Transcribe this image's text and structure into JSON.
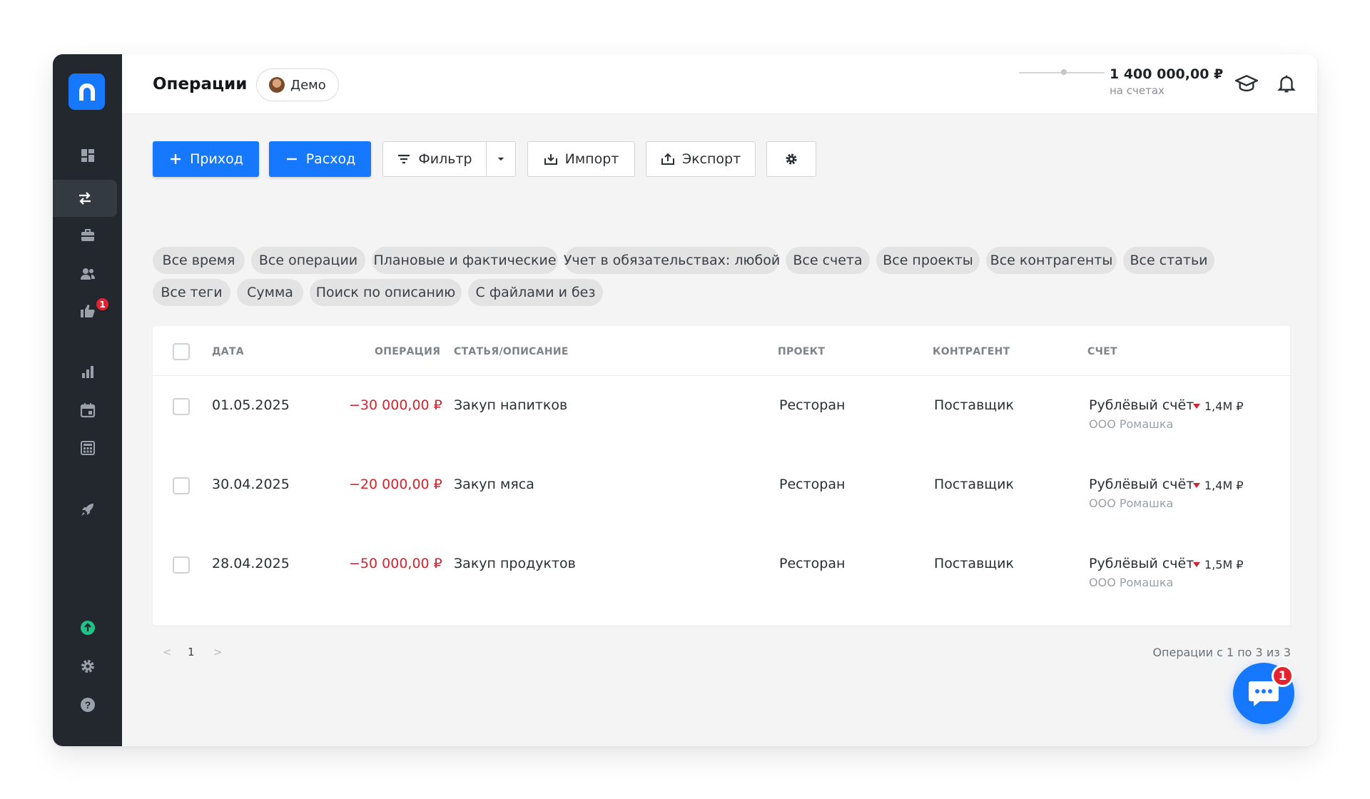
{
  "header": {
    "title": "Операции",
    "demo_label": "Демо",
    "balance_amount": "1 400 000,00 ₽",
    "balance_caption": "на счетах"
  },
  "sidebar": {
    "items": [
      {
        "name": "dashboard",
        "icon": "dashboard-icon"
      },
      {
        "name": "operations",
        "icon": "transfer-arrows-icon",
        "active": true
      },
      {
        "name": "projects",
        "icon": "briefcase-icon"
      },
      {
        "name": "contractors",
        "icon": "users-icon"
      },
      {
        "name": "deals",
        "icon": "thumb-up-icon",
        "badge": "1"
      },
      {
        "name": "reports",
        "icon": "bar-chart-icon"
      },
      {
        "name": "calendar",
        "icon": "calendar-icon"
      },
      {
        "name": "calculator",
        "icon": "calculator-icon"
      },
      {
        "name": "rocket",
        "icon": "rocket-icon"
      },
      {
        "name": "upgrade",
        "icon": "upload-circle-icon"
      },
      {
        "name": "settings",
        "icon": "gear-icon"
      },
      {
        "name": "help",
        "icon": "help-icon"
      }
    ]
  },
  "toolbar": {
    "income_label": "Приход",
    "expense_label": "Расход",
    "filter_label": "Фильтр",
    "import_label": "Импорт",
    "export_label": "Экспорт"
  },
  "filters": [
    "Все время",
    "Все операции",
    "Плановые и фактические",
    "Учет в обязательствах: любой",
    "Все счета",
    "Все проекты",
    "Все контрагенты",
    "Все статьи",
    "Все теги",
    "Сумма",
    "Поиск по описанию",
    "С файлами и без"
  ],
  "table": {
    "columns": [
      "ДАТА",
      "ОПЕРАЦИЯ",
      "СТАТЬЯ/ОПИСАНИЕ",
      "ПРОЕКТ",
      "КОНТРАГЕНТ",
      "СЧЕТ"
    ],
    "rows": [
      {
        "date": "01.05.2025",
        "amount": "−30 000,00 ₽",
        "description": "Закуп напитков",
        "project": "Ресторан",
        "contractor": "Поставщик",
        "account": "Рублёвый счёт",
        "account_balance": "1,4М ₽",
        "company": "ООО Ромашка"
      },
      {
        "date": "30.04.2025",
        "amount": "−20 000,00 ₽",
        "description": "Закуп мяса",
        "project": "Ресторан",
        "contractor": "Поставщик",
        "account": "Рублёвый счёт",
        "account_balance": "1,4М ₽",
        "company": "ООО Ромашка"
      },
      {
        "date": "28.04.2025",
        "amount": "−50 000,00 ₽",
        "description": "Закуп продуктов",
        "project": "Ресторан",
        "contractor": "Поставщик",
        "account": "Рублёвый счёт",
        "account_balance": "1,5М ₽",
        "company": "ООО Ромашка"
      }
    ]
  },
  "pagination": {
    "prev": "<",
    "page": "1",
    "next": ">",
    "summary": "Операции с 1 по 3 из 3"
  },
  "chat": {
    "badge": "1"
  },
  "colors": {
    "accent": "#1677ff",
    "negative": "#d5222e",
    "sidebar": "#23272e",
    "badge": "#e5232f"
  }
}
